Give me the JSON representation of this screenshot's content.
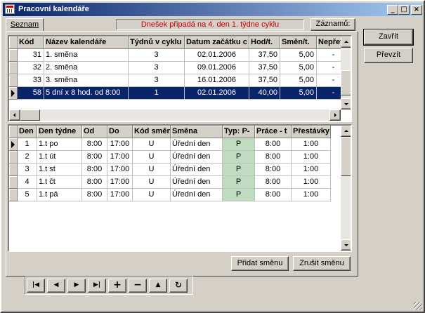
{
  "window": {
    "title": "Pracovní kalendáře"
  },
  "title_buttons": {
    "minimize": "_",
    "maximize": "□",
    "close": "×"
  },
  "tab": {
    "label": "Seznam"
  },
  "status_text": "Dnešek připadá na 4. den 1. týdne cyklu",
  "records_button": "Záznamů:",
  "buttons": {
    "close": "Zavřít",
    "take": "Převzít",
    "add_shift": "Přidat směnu",
    "remove_shift": "Zrušit směnu"
  },
  "calendars": {
    "columns": [
      "Kód",
      "Název kalendáře",
      "Týdnů v cyklu",
      "Datum začátku c",
      "Hod/t.",
      "Směn/t.",
      "Nepřeto"
    ],
    "rows": [
      [
        "31",
        "1. směna",
        "3",
        "02.01.2006",
        "37,50",
        "5,00",
        "-"
      ],
      [
        "32",
        "2. směna",
        "3",
        "09.01.2006",
        "37,50",
        "5,00",
        "-"
      ],
      [
        "33",
        "3. směna",
        "3",
        "16.01.2006",
        "37,50",
        "5,00",
        "-"
      ],
      [
        "58",
        "5 dní x 8 hod. od 8:00",
        "1",
        "02.01.2006",
        "40,00",
        "5,00",
        "-"
      ]
    ],
    "selected_row": 3
  },
  "shifts": {
    "columns": [
      "Den",
      "Den týdne",
      "Od",
      "Do",
      "Kód směny",
      "Směna",
      "Typ: P-",
      "Práce - t",
      "Přestávky"
    ],
    "rows": [
      [
        "1",
        "1.t po",
        "8:00",
        "17:00",
        "U",
        "Úřední den",
        "P",
        "8:00",
        "1:00"
      ],
      [
        "2",
        "1.t út",
        "8:00",
        "17:00",
        "U",
        "Úřední den",
        "P",
        "8:00",
        "1:00"
      ],
      [
        "3",
        "1.t st",
        "8:00",
        "17:00",
        "U",
        "Úřední den",
        "P",
        "8:00",
        "1:00"
      ],
      [
        "4",
        "1.t čt",
        "8:00",
        "17:00",
        "U",
        "Úřední den",
        "P",
        "8:00",
        "1:00"
      ],
      [
        "5",
        "1.t pá",
        "8:00",
        "17:00",
        "U",
        "Úřední den",
        "P",
        "8:00",
        "1:00"
      ]
    ],
    "current_row": 0
  },
  "navigator": {
    "first": "|◀",
    "prev": "◀",
    "next": "▶",
    "last": "▶|",
    "insert": "+",
    "delete": "−",
    "post": "▲",
    "refresh": "↻"
  },
  "colors": {
    "selection": "#0a246a",
    "status_text": "#c00000",
    "type_cell": "#c0dcc0"
  }
}
